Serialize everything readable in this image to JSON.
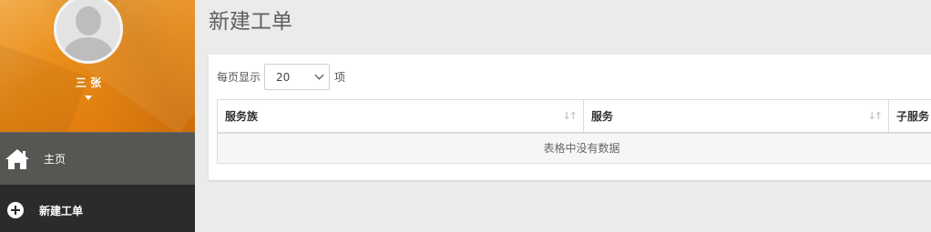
{
  "user": {
    "name": "三 张"
  },
  "nav": {
    "home": {
      "label": "主页",
      "icon": "home-icon"
    },
    "new_ticket": {
      "label": "新建工单",
      "icon": "plus-circle-icon"
    }
  },
  "page": {
    "title": "新建工单"
  },
  "table_controls": {
    "length_prefix": "每页显示",
    "length_value": "20",
    "length_suffix": "项"
  },
  "table": {
    "columns": [
      "服务族",
      "服务",
      "子服务"
    ],
    "sort_icon": "sort-icon",
    "empty_message": "表格中没有数据"
  },
  "colors": {
    "profile_bg": "#e98a16",
    "nav_home_bg": "#575653",
    "nav_active_bg": "#2b2b2b",
    "page_bg": "#ebebeb"
  }
}
